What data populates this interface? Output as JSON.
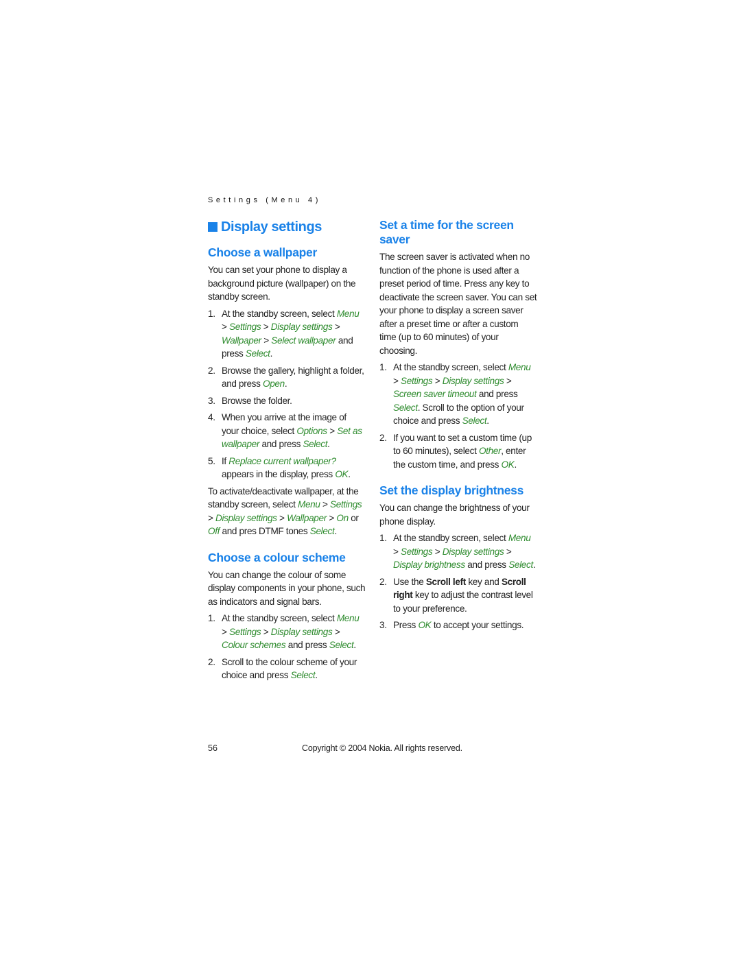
{
  "running_head": "Settings (Menu 4)",
  "left": {
    "title": "Display settings",
    "wallpaper": {
      "heading": "Choose a wallpaper",
      "intro": "You can set your phone to display a background picture (wallpaper) on the standby screen.",
      "steps": [
        {
          "num": "1.",
          "parts": [
            [
              "t",
              "At the standby screen, select "
            ],
            [
              "g",
              "Menu"
            ],
            [
              "t",
              " > "
            ],
            [
              "g",
              "Settings"
            ],
            [
              "t",
              " > "
            ],
            [
              "g",
              "Display settings"
            ],
            [
              "t",
              " > "
            ],
            [
              "g",
              "Wallpaper"
            ],
            [
              "t",
              " > "
            ],
            [
              "g",
              "Select wallpaper"
            ],
            [
              "t",
              " and press "
            ],
            [
              "g",
              "Select"
            ],
            [
              "t",
              "."
            ]
          ]
        },
        {
          "num": "2.",
          "parts": [
            [
              "t",
              "Browse the gallery, highlight a folder, and press "
            ],
            [
              "g",
              "Open"
            ],
            [
              "t",
              "."
            ]
          ]
        },
        {
          "num": "3.",
          "parts": [
            [
              "t",
              "Browse the folder."
            ]
          ]
        },
        {
          "num": "4.",
          "parts": [
            [
              "t",
              "When you arrive at the image of your choice, select "
            ],
            [
              "g",
              "Options"
            ],
            [
              "t",
              " > "
            ],
            [
              "g",
              "Set as wallpaper"
            ],
            [
              "t",
              " and press "
            ],
            [
              "g",
              "Select"
            ],
            [
              "t",
              "."
            ]
          ]
        },
        {
          "num": "5.",
          "parts": [
            [
              "t",
              "If "
            ],
            [
              "g",
              "Replace current wallpaper?"
            ],
            [
              "t",
              " appears in the display, press "
            ],
            [
              "g",
              "OK"
            ],
            [
              "t",
              "."
            ]
          ]
        }
      ],
      "activate_note": [
        [
          "t",
          "To activate/deactivate wallpaper, at the standby screen, select "
        ],
        [
          "g",
          "Menu"
        ],
        [
          "t",
          " > "
        ],
        [
          "g",
          "Settings"
        ],
        [
          "t",
          " > "
        ],
        [
          "g",
          "Display settings"
        ],
        [
          "t",
          " > "
        ],
        [
          "g",
          "Wallpaper"
        ],
        [
          "t",
          " > "
        ],
        [
          "g",
          "On"
        ],
        [
          "t",
          " or "
        ],
        [
          "g",
          "Off"
        ],
        [
          "t",
          " and pres DTMF tones "
        ],
        [
          "g",
          "Select"
        ],
        [
          "t",
          "."
        ]
      ]
    },
    "colour": {
      "heading": "Choose a colour scheme",
      "intro": "You can change the colour of some display components in your phone, such as indicators and signal bars.",
      "steps": [
        {
          "num": "1.",
          "parts": [
            [
              "t",
              "At the standby screen, select "
            ],
            [
              "g",
              "Menu"
            ],
            [
              "t",
              " > "
            ],
            [
              "g",
              "Settings"
            ],
            [
              "t",
              " > "
            ],
            [
              "g",
              "Display settings"
            ],
            [
              "t",
              " > "
            ],
            [
              "g",
              "Colour schemes"
            ],
            [
              "t",
              " and press "
            ],
            [
              "g",
              "Select"
            ],
            [
              "t",
              "."
            ]
          ]
        },
        {
          "num": "2.",
          "parts": [
            [
              "t",
              "Scroll to the colour scheme of your choice and press "
            ],
            [
              "g",
              "Select"
            ],
            [
              "t",
              "."
            ]
          ]
        }
      ]
    }
  },
  "right": {
    "saver": {
      "heading": "Set a time for the screen saver",
      "intro": "The screen saver is activated when no function of the phone is used after a preset period of time. Press any key to deactivate the screen saver. You can set your phone to display a screen saver after a preset time or after a custom time (up to 60 minutes) of your choosing.",
      "steps": [
        {
          "num": "1.",
          "parts": [
            [
              "t",
              "At the standby screen, select "
            ],
            [
              "g",
              "Menu"
            ],
            [
              "t",
              " > "
            ],
            [
              "g",
              "Settings"
            ],
            [
              "t",
              " > "
            ],
            [
              "g",
              "Display settings"
            ],
            [
              "t",
              " > "
            ],
            [
              "g",
              "Screen saver timeout"
            ],
            [
              "t",
              " and press "
            ],
            [
              "g",
              "Select"
            ],
            [
              "t",
              ". Scroll to the option of your choice and press "
            ],
            [
              "g",
              "Select"
            ],
            [
              "t",
              "."
            ]
          ]
        },
        {
          "num": "2.",
          "parts": [
            [
              "t",
              "If you want to set a custom time (up to 60 minutes), select "
            ],
            [
              "g",
              "Other"
            ],
            [
              "t",
              ", enter the custom time, and press "
            ],
            [
              "g",
              "OK"
            ],
            [
              "t",
              "."
            ]
          ]
        }
      ]
    },
    "brightness": {
      "heading": "Set the display brightness",
      "intro": "You can change the brightness of your phone display.",
      "steps": [
        {
          "num": "1.",
          "parts": [
            [
              "t",
              "At the standby screen, select "
            ],
            [
              "g",
              "Menu"
            ],
            [
              "t",
              " > "
            ],
            [
              "g",
              "Settings"
            ],
            [
              "t",
              " > "
            ],
            [
              "g",
              "Display settings"
            ],
            [
              "t",
              " > "
            ],
            [
              "g",
              "Display brightness"
            ],
            [
              "t",
              " and press "
            ],
            [
              "g",
              "Select"
            ],
            [
              "t",
              "."
            ]
          ]
        },
        {
          "num": "2.",
          "parts": [
            [
              "t",
              "Use the "
            ],
            [
              "b",
              "Scroll left"
            ],
            [
              "t",
              " key and "
            ],
            [
              "b",
              "Scroll right"
            ],
            [
              "t",
              " key to adjust the contrast level to your preference."
            ]
          ]
        },
        {
          "num": "3.",
          "parts": [
            [
              "t",
              "Press "
            ],
            [
              "g",
              "OK"
            ],
            [
              "t",
              " to accept your settings."
            ]
          ]
        }
      ]
    }
  },
  "footer": {
    "page_number": "56",
    "copyright": "Copyright © 2004 Nokia. All rights reserved."
  },
  "colors": {
    "heading_blue": "#1a82e8",
    "menu_green": "#2e8b2e",
    "body_text": "#222222"
  }
}
